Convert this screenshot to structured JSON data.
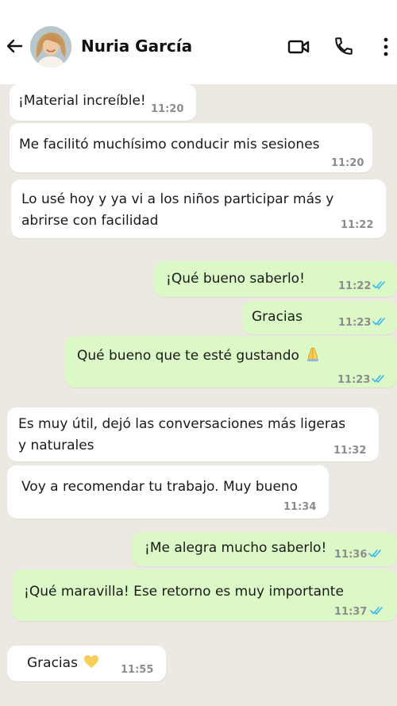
{
  "header": {
    "contact_name": "Nuria García",
    "icons": [
      "back-arrow-icon",
      "video-call-icon",
      "phone-icon",
      "more-vert-icon"
    ]
  },
  "colors": {
    "incoming_bubble": "#ffffff",
    "outgoing_bubble": "#dcf8c6",
    "background": "#ece8e2",
    "read_ticks": "#34b7f1",
    "timestamp": "#8c8c8c"
  },
  "messages": [
    {
      "dir": "in",
      "text": "¡Material increíble!",
      "time": "11:20"
    },
    {
      "dir": "in",
      "text": "Me facilitó muchísimo conducir mis sesiones",
      "time": "11:20"
    },
    {
      "dir": "in",
      "line1": "Lo usé hoy y ya vi a los niños participar más y",
      "line2": "abrirse con facilidad",
      "time": "11:22"
    },
    {
      "dir": "out",
      "text": "¡Qué bueno saberlo!",
      "time": "11:22",
      "status": "read"
    },
    {
      "dir": "out",
      "text": "Gracias",
      "time": "11:23",
      "status": "read"
    },
    {
      "dir": "out",
      "text": "Qué bueno que te esté gustando",
      "emoji": "folded-hands",
      "time": "11:23",
      "status": "read"
    },
    {
      "dir": "in",
      "line1": "Es muy útil, dejó las conversaciones más ligeras",
      "line2": "y naturales",
      "time": "11:32"
    },
    {
      "dir": "in",
      "text": "Voy a recomendar tu trabajo. Muy bueno",
      "time": "11:34"
    },
    {
      "dir": "out",
      "text": "¡Me alegra mucho saberlo!",
      "time": "11:36",
      "status": "read"
    },
    {
      "dir": "out",
      "text": "¡Qué maravilla! Ese retorno es muy importante",
      "time": "11:37",
      "status": "read"
    },
    {
      "dir": "in",
      "text": "Gracias",
      "emoji": "yellow-heart",
      "time": "11:55"
    }
  ]
}
